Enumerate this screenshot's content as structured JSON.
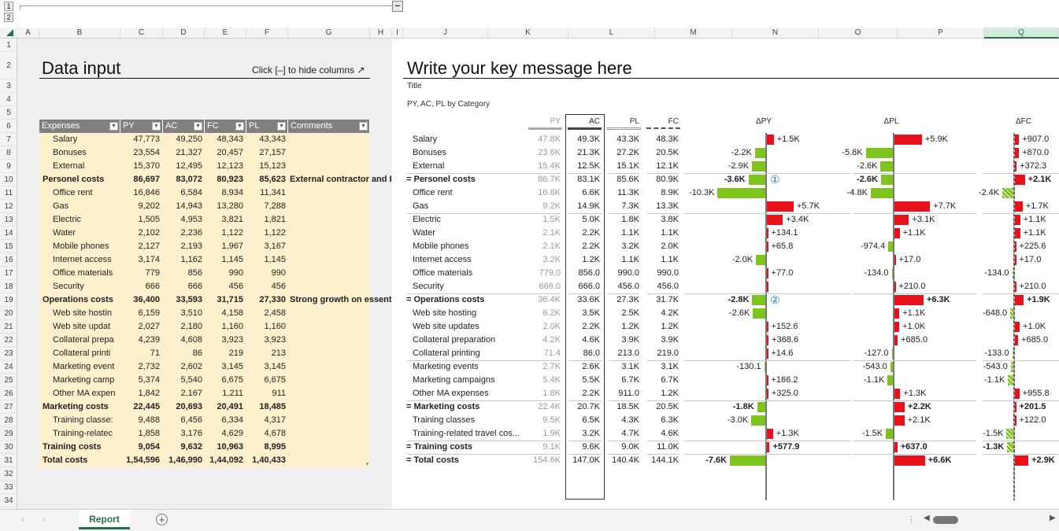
{
  "outline": {
    "levels": [
      "1",
      "2"
    ],
    "collapse_button": "−"
  },
  "columns": [
    "A",
    "B",
    "C",
    "D",
    "E",
    "F",
    "G",
    "H",
    "I",
    "J",
    "K",
    "L",
    "M",
    "N",
    "O",
    "P",
    "Q"
  ],
  "rows_numbers": [
    "1",
    "2",
    "3",
    "4",
    "5",
    "6",
    "7",
    "8",
    "9",
    "10",
    "11",
    "12",
    "13",
    "14",
    "15",
    "16",
    "17",
    "18",
    "19",
    "20",
    "21",
    "22",
    "23",
    "24",
    "25",
    "26",
    "27",
    "28",
    "29",
    "30",
    "31",
    "32",
    "33",
    "34"
  ],
  "left": {
    "title": "Data input",
    "hint": "Click [–] to hide columns ↗",
    "headers": [
      "Expenses",
      "PY",
      "AC",
      "FC",
      "PL",
      "Comments"
    ],
    "rows": [
      {
        "label": "Salary",
        "py": "47,773",
        "ac": "49,250",
        "fc": "48,343",
        "pl": "43,343",
        "v": [
          47773,
          49250,
          48343,
          43343
        ]
      },
      {
        "label": "Bonuses",
        "py": "23,554",
        "ac": "21,327",
        "fc": "20,457",
        "pl": "27,157",
        "v": [
          23554,
          21327,
          20457,
          27157
        ]
      },
      {
        "label": "External",
        "py": "15,370",
        "ac": "12,495",
        "fc": "12,123",
        "pl": "15,123",
        "v": [
          15370,
          12495,
          12123,
          15123
        ]
      },
      {
        "label": "Personel costs",
        "bold": true,
        "py": "86,697",
        "ac": "83,072",
        "fc": "80,923",
        "pl": "85,623",
        "comment": "External contractor and Bo",
        "v": [
          86697,
          83072,
          80923,
          85623
        ]
      },
      {
        "label": "Office rent",
        "py": "16,846",
        "ac": "6,584",
        "fc": "8,934",
        "pl": "11,341",
        "v": [
          16846,
          6584,
          8934,
          11341
        ]
      },
      {
        "label": "Gas",
        "py": "9,202",
        "ac": "14,943",
        "fc": "13,280",
        "pl": "7,288",
        "v": [
          9202,
          14943,
          13280,
          7288
        ]
      },
      {
        "label": "Electric",
        "py": "1,505",
        "ac": "4,953",
        "fc": "3,821",
        "pl": "1,821",
        "v": [
          1505,
          4953,
          3821,
          1821
        ]
      },
      {
        "label": "Water",
        "py": "2,102",
        "ac": "2,236",
        "fc": "1,122",
        "pl": "1,122",
        "v": [
          2102,
          2236,
          1122,
          1122
        ]
      },
      {
        "label": "Mobile phones",
        "py": "2,127",
        "ac": "2,193",
        "fc": "1,967",
        "pl": "3,167",
        "v": [
          2127,
          2193,
          1967,
          3167
        ]
      },
      {
        "label": "Internet access",
        "py": "3,174",
        "ac": "1,162",
        "fc": "1,145",
        "pl": "1,145",
        "v": [
          3174,
          1162,
          1145,
          1145
        ]
      },
      {
        "label": "Office materials",
        "py": "779",
        "ac": "856",
        "fc": "990",
        "pl": "990",
        "v": [
          779,
          856,
          990,
          990
        ]
      },
      {
        "label": "Security",
        "py": "666",
        "ac": "666",
        "fc": "456",
        "pl": "456",
        "v": [
          666,
          666,
          456,
          456
        ]
      },
      {
        "label": "Operations costs",
        "bold": true,
        "py": "36,400",
        "ac": "33,593",
        "fc": "31,715",
        "pl": "27,330",
        "comment": "Strong growth on essentia",
        "v": [
          36400,
          33593,
          31715,
          27330
        ]
      },
      {
        "label": "Web site hostin",
        "py": "6,159",
        "ac": "3,510",
        "fc": "4,158",
        "pl": "2,458",
        "v": [
          6159,
          3510,
          4158,
          2458
        ]
      },
      {
        "label": "Web site updat",
        "py": "2,027",
        "ac": "2,180",
        "fc": "1,160",
        "pl": "1,160",
        "v": [
          2027,
          2180,
          1160,
          1160
        ]
      },
      {
        "label": "Collateral prepa",
        "py": "4,239",
        "ac": "4,608",
        "fc": "3,923",
        "pl": "3,923",
        "v": [
          4239,
          4608,
          3923,
          3923
        ]
      },
      {
        "label": "Collateral printi",
        "py": "71",
        "ac": "86",
        "fc": "219",
        "pl": "213",
        "v": [
          71,
          86,
          219,
          213
        ]
      },
      {
        "label": "Marketing event",
        "py": "2,732",
        "ac": "2,602",
        "fc": "3,145",
        "pl": "3,145",
        "v": [
          2732,
          2602,
          3145,
          3145
        ]
      },
      {
        "label": "Marketing camp",
        "py": "5,374",
        "ac": "5,540",
        "fc": "6,675",
        "pl": "6,675",
        "v": [
          5374,
          5540,
          6675,
          6675
        ]
      },
      {
        "label": "Other MA expen",
        "py": "1,842",
        "ac": "2,167",
        "fc": "1,211",
        "pl": "911",
        "v": [
          1842,
          2167,
          1211,
          911
        ]
      },
      {
        "label": "Marketing costs",
        "bold": true,
        "py": "22,445",
        "ac": "20,693",
        "fc": "20,491",
        "pl": "18,485",
        "v": [
          22445,
          20693,
          20491,
          18485
        ]
      },
      {
        "label": "Training classe:",
        "py": "9,488",
        "ac": "6,456",
        "fc": "6,334",
        "pl": "4,317",
        "v": [
          9488,
          6456,
          6334,
          4317
        ]
      },
      {
        "label": "Training-relatec",
        "py": "1,858",
        "ac": "3,176",
        "fc": "4,629",
        "pl": "4,678",
        "v": [
          1858,
          3176,
          4629,
          4678
        ]
      },
      {
        "label": "Training costs",
        "bold": true,
        "py": "9,054",
        "ac": "9,632",
        "fc": "10,963",
        "pl": "8,995",
        "v": [
          9054,
          9632,
          10963,
          8995
        ]
      },
      {
        "label": "Total costs",
        "bold": true,
        "total": true,
        "py": "1,54,596",
        "ac": "1,46,990",
        "fc": "1,44,092",
        "pl": "1,40,433",
        "v": [
          154596,
          146990,
          144092,
          140433
        ]
      }
    ]
  },
  "right": {
    "title": "Write your key message here",
    "subtitle": "Title",
    "caption": "PY, AC, PL by Category",
    "headers": {
      "py": "PY",
      "ac": "AC",
      "pl": "PL",
      "fc": "FC",
      "dpy": "ΔPY",
      "dpl": "ΔPL",
      "dfc": "ΔFC"
    },
    "markers": [
      "①",
      "②"
    ],
    "rows": [
      {
        "label": "Salary",
        "py": "47.8K",
        "ac": "49.3K",
        "pl": "43.3K",
        "fc": "48.3K",
        "dpy": "+1.5K",
        "dpl": "+5.9K",
        "dfc": "+907.0"
      },
      {
        "label": "Bonuses",
        "py": "23.6K",
        "ac": "21.3K",
        "pl": "27.2K",
        "fc": "20.5K",
        "dpy": "-2.2K",
        "dpl": "-5.8K",
        "dfc": "+870.0"
      },
      {
        "label": "External",
        "py": "15.4K",
        "ac": "12.5K",
        "pl": "15.1K",
        "fc": "12.1K",
        "dpy": "-2.9K",
        "dpl": "-2.6K",
        "dfc": "+372.3"
      },
      {
        "label": "= Personel costs",
        "bold": true,
        "py": "86.7K",
        "ac": "83.1K",
        "pl": "85.6K",
        "fc": "80.9K",
        "dpy": "-3.6K",
        "dpl": "-2.6K",
        "dfc": "+2.1K",
        "marker": 0
      },
      {
        "label": "Office rent",
        "py": "16.8K",
        "ac": "6.6K",
        "pl": "11.3K",
        "fc": "8.9K",
        "dpy": "-10.3K",
        "dpl": "-4.8K",
        "dfc": "-2.4K"
      },
      {
        "label": "Gas",
        "py": "9.2K",
        "ac": "14.9K",
        "pl": "7.3K",
        "fc": "13.3K",
        "dpy": "+5.7K",
        "dpl": "+7.7K",
        "dfc": "+1.7K"
      },
      {
        "label": "Electric",
        "py": "1.5K",
        "ac": "5.0K",
        "pl": "1.8K",
        "fc": "3.8K",
        "dpy": "+3.4K",
        "dpl": "+3.1K",
        "dfc": "+1.1K"
      },
      {
        "label": "Water",
        "py": "2.1K",
        "ac": "2.2K",
        "pl": "1.1K",
        "fc": "1.1K",
        "dpy": "+134.1",
        "dpl": "+1.1K",
        "dfc": "+1.1K"
      },
      {
        "label": "Mobile phones",
        "py": "2.1K",
        "ac": "2.2K",
        "pl": "3.2K",
        "fc": "2.0K",
        "dpy": "+65.8",
        "dpl": "-974.4",
        "dfc": "+225.6"
      },
      {
        "label": "Internet access",
        "py": "3.2K",
        "ac": "1.2K",
        "pl": "1.1K",
        "fc": "1.1K",
        "dpy": "-2.0K",
        "dpl": "+17.0",
        "dfc": "+17.0"
      },
      {
        "label": "Office materials",
        "py": "779.0",
        "ac": "856.0",
        "pl": "990.0",
        "fc": "990.0",
        "dpy": "+77.0",
        "dpl": "-134.0",
        "dfc": "-134.0"
      },
      {
        "label": "Security",
        "py": "666.0",
        "ac": "666.0",
        "pl": "456.0",
        "fc": "456.0",
        "dpy": "",
        "dpl": "+210.0",
        "dfc": "+210.0"
      },
      {
        "label": "= Operations costs",
        "bold": true,
        "py": "36.4K",
        "ac": "33.6K",
        "pl": "27.3K",
        "fc": "31.7K",
        "dpy": "-2.8K",
        "dpl": "+6.3K",
        "dfc": "+1.9K",
        "marker": 1
      },
      {
        "label": "Web site hosting",
        "py": "6.2K",
        "ac": "3.5K",
        "pl": "2.5K",
        "fc": "4.2K",
        "dpy": "-2.6K",
        "dpl": "+1.1K",
        "dfc": "-648.0"
      },
      {
        "label": "Web site updates",
        "py": "2.0K",
        "ac": "2.2K",
        "pl": "1.2K",
        "fc": "1.2K",
        "dpy": "+152.6",
        "dpl": "+1.0K",
        "dfc": "+1.0K"
      },
      {
        "label": "Collateral preparation",
        "py": "4.2K",
        "ac": "4.6K",
        "pl": "3.9K",
        "fc": "3.9K",
        "dpy": "+368.6",
        "dpl": "+685.0",
        "dfc": "+685.0"
      },
      {
        "label": "Collateral printing",
        "py": "71.4",
        "ac": "86.0",
        "pl": "213.0",
        "fc": "219.0",
        "dpy": "+14.6",
        "dpl": "-127.0",
        "dfc": "-133.0"
      },
      {
        "label": "Marketing events",
        "py": "2.7K",
        "ac": "2.6K",
        "pl": "3.1K",
        "fc": "3.1K",
        "dpy": "-130.1",
        "dpl": "-543.0",
        "dfc": "-543.0"
      },
      {
        "label": "Marketing campaigns",
        "py": "5.4K",
        "ac": "5.5K",
        "pl": "6.7K",
        "fc": "6.7K",
        "dpy": "+166.2",
        "dpl": "-1.1K",
        "dfc": "-1.1K"
      },
      {
        "label": "Other MA expenses",
        "py": "1.8K",
        "ac": "2.2K",
        "pl": "911.0",
        "fc": "1.2K",
        "dpy": "+325.0",
        "dpl": "+1.3K",
        "dfc": "+955.8"
      },
      {
        "label": "= Marketing costs",
        "bold": true,
        "py": "22.4K",
        "ac": "20.7K",
        "pl": "18.5K",
        "fc": "20.5K",
        "dpy": "-1.8K",
        "dpl": "+2.2K",
        "dfc": "+201.5"
      },
      {
        "label": "Training classes",
        "py": "9.5K",
        "ac": "6.5K",
        "pl": "4.3K",
        "fc": "6.3K",
        "dpy": "-3.0K",
        "dpl": "+2.1K",
        "dfc": "+122.0"
      },
      {
        "label": "Training-related travel cos...",
        "py": "1.9K",
        "ac": "3.2K",
        "pl": "4.7K",
        "fc": "4.6K",
        "dpy": "+1.3K",
        "dpl": "-1.5K",
        "dfc": "-1.5K"
      },
      {
        "label": "= Training costs",
        "bold": true,
        "py": "9.1K",
        "ac": "9.6K",
        "pl": "9.0K",
        "fc": "11.0K",
        "dpy": "+577.9",
        "dpl": "+637.0",
        "dfc": "-1.3K"
      },
      {
        "label": "= Total costs",
        "bold": true,
        "py": "154.6K",
        "ac": "147.0K",
        "pl": "140.4K",
        "fc": "144.1K",
        "dpy": "-7.6K",
        "dpl": "+6.6K",
        "dfc": "+2.9K"
      }
    ]
  },
  "colors": {
    "increase": "#e8101a",
    "decrease": "#7dc41d",
    "header_fill": "#808080",
    "input_fill": "#fdf0cc",
    "tab_accent": "#217346"
  },
  "tabs": {
    "sheets": [
      "Report"
    ],
    "active": "Report",
    "add_icon": "plus-circle-icon"
  }
}
